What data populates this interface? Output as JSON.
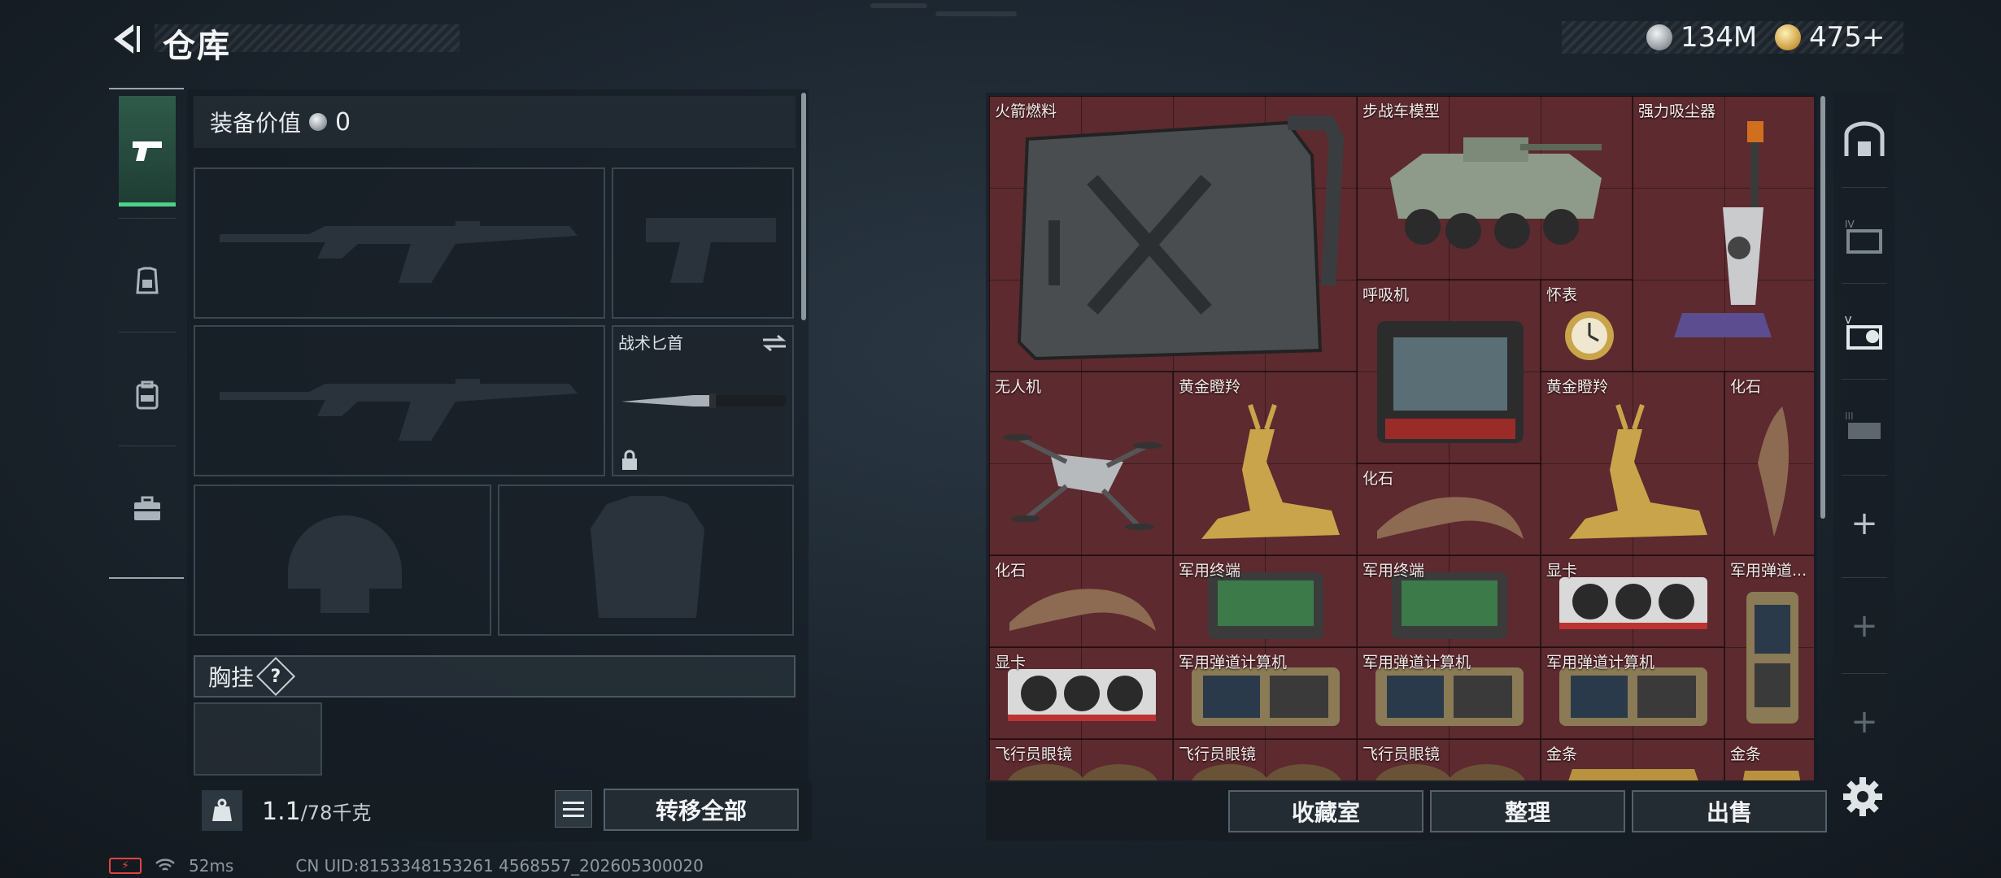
{
  "header": {
    "title": "仓库",
    "currency_silver": "134M",
    "currency_gold": "475+"
  },
  "loadout": {
    "equip_value_label": "装备价值",
    "equip_value": "0",
    "knife_label": "战术匕首",
    "chest_label": "胸挂",
    "help": "?",
    "weight_value": "1.1",
    "weight_max": "/78千克",
    "transfer_all": "转移全部"
  },
  "stash": {
    "items": [
      {
        "name": "火箭燃料"
      },
      {
        "name": "步战车模型"
      },
      {
        "name": "强力吸尘器"
      },
      {
        "name": "呼吸机"
      },
      {
        "name": "怀表"
      },
      {
        "name": "无人机"
      },
      {
        "name": "黄金瞪羚"
      },
      {
        "name": "化石"
      },
      {
        "name": "黄金瞪羚"
      },
      {
        "name": "化石"
      },
      {
        "name": "化石"
      },
      {
        "name": "军用终端"
      },
      {
        "name": "军用终端"
      },
      {
        "name": "显卡"
      },
      {
        "name": "军用弹道..."
      },
      {
        "name": "显卡"
      },
      {
        "name": "军用弹道计算机"
      },
      {
        "name": "军用弹道计算机"
      },
      {
        "name": "军用弹道计算机"
      },
      {
        "name": "飞行员眼镜"
      },
      {
        "name": "飞行员眼镜"
      },
      {
        "name": "飞行员眼镜"
      },
      {
        "name": "金条"
      },
      {
        "name": "金条"
      }
    ],
    "buttons": {
      "collection": "收藏室",
      "organize": "整理",
      "sell": "出售"
    }
  },
  "status": {
    "ping": "52ms",
    "uid": "CN UID:8153348153261 4568557_202605300020"
  },
  "colors": {
    "accent_green": "#4fd18a",
    "stash_red": "#5c2a2f",
    "battery_red": "#e0453f"
  }
}
